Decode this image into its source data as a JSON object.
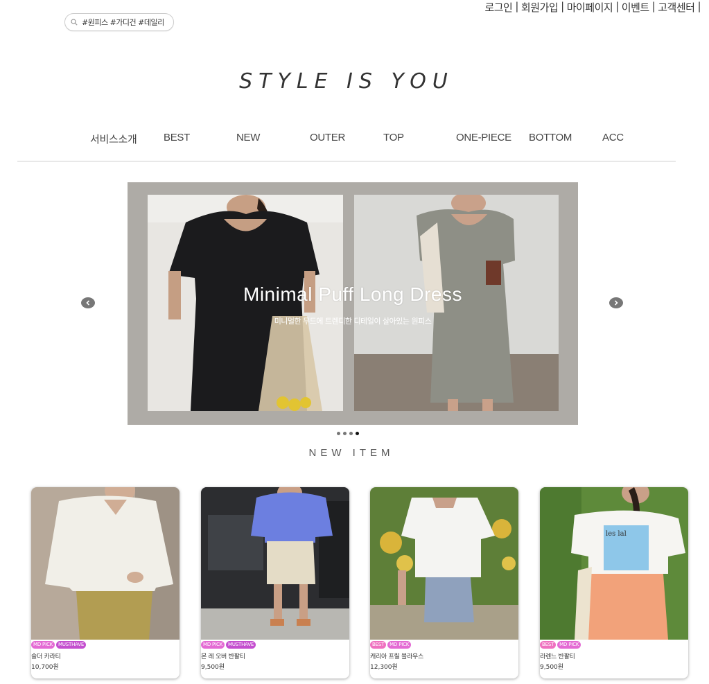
{
  "top_links": [
    "로그인",
    "회원가입",
    "마이페이지",
    "이벤트",
    "고객센터"
  ],
  "top_sep": "|",
  "search": {
    "placeholder": "#원피스 #가디건 #데일리"
  },
  "logo": "STYLE IS YOU",
  "nav": [
    "서비스소개",
    "BEST",
    "NEW",
    "OUTER",
    "TOP",
    "ONE-PIECE",
    "BOTTOM",
    "ACC"
  ],
  "banner": {
    "title": "Minimal Puff Long Dress",
    "subtitle": "미니멀한 무드에 트렌디한 디테일이 살아있는 원피스",
    "slide_count": 4,
    "active_slide": 4
  },
  "section_title": "NEW ITEM",
  "products": [
    {
      "badges": [
        "MD PICK",
        "MUSTHAVE"
      ],
      "name": "슬더 카라티",
      "price": "10,700원"
    },
    {
      "badges": [
        "MD PICK",
        "MUSTHAVE"
      ],
      "name": "몬 레 오버 반팔티",
      "price": "9,500원"
    },
    {
      "badges": [
        "BEST",
        "MD PICK"
      ],
      "name": "캐리아 프릴 블라우스",
      "price": "12,300원"
    },
    {
      "badges": [
        "BEST",
        "MD PICK"
      ],
      "name": "라렌느 반팔티",
      "price": "9,500원"
    }
  ]
}
